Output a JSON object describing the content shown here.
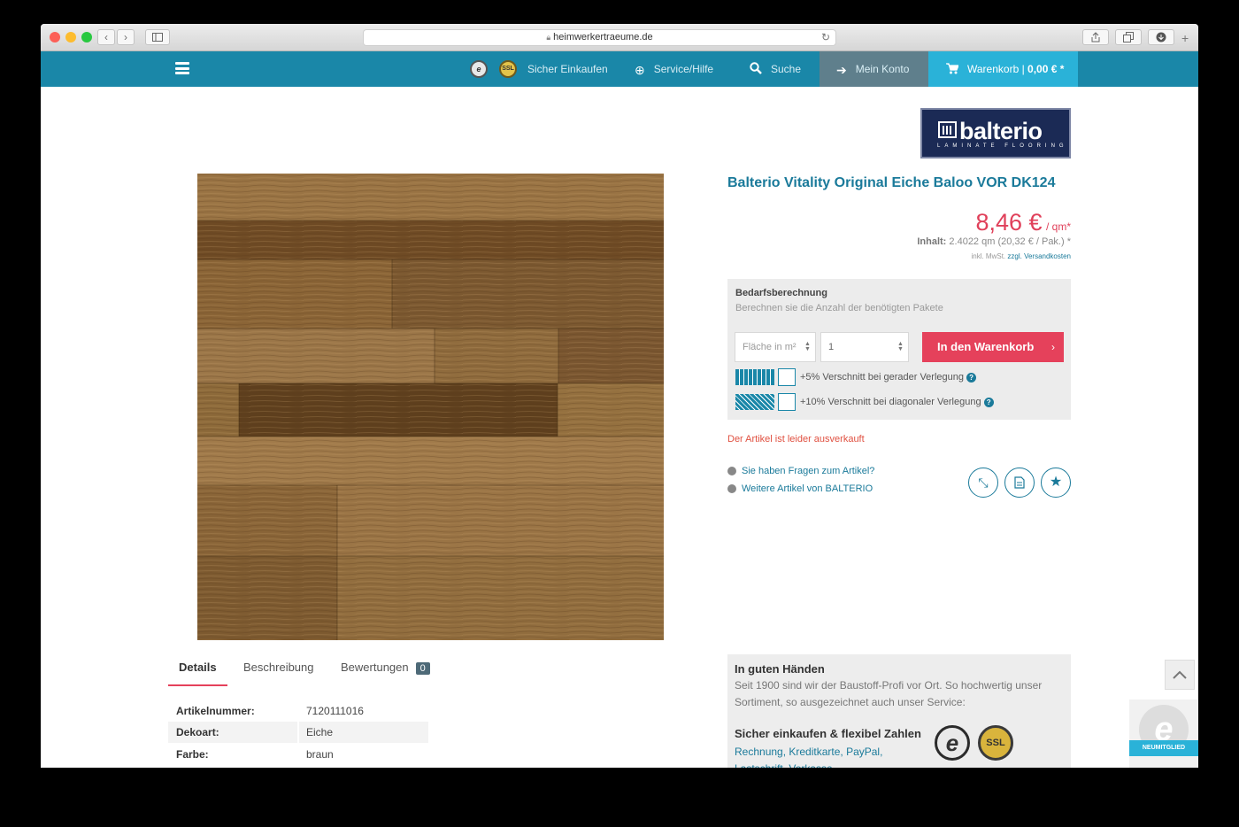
{
  "browser": {
    "url": "heimwerkertraeume.de",
    "back_label": "‹",
    "forward_label": "›"
  },
  "nav": {
    "secure_shopping": "Sicher Einkaufen",
    "service": "Service/Hilfe",
    "search": "Suche",
    "account": "Mein Konto",
    "cart_label": "Warenkorb",
    "cart_amount": "0,00 € *",
    "colors": {
      "bar": "#1a87a8",
      "account": "#5f7f8c",
      "cart": "#2ab2d8"
    }
  },
  "brand": {
    "name": "balterio",
    "tagline": "LAMINATE FLOORING"
  },
  "product": {
    "title": "Balterio Vitality Original Eiche Baloo VOR DK124",
    "price": "8,46 €",
    "price_unit": "/ qm*",
    "content_label": "Inhalt:",
    "content_value": "2.4022 qm (20,32 € / Pak.) *",
    "tax_note": "inkl. MwSt.",
    "shipping_link": "zzgl. Versandkosten",
    "sold_out": "Der Artikel ist leider ausverkauft",
    "accent_color": "#e0405a"
  },
  "calculator": {
    "heading": "Bedarfsberechnung",
    "subheading": "Berechnen sie die Anzahl der benötigten Pakete",
    "area_placeholder": "Fläche in m²",
    "quantity_value": "1",
    "add_to_cart": "In den Warenkorb",
    "option_straight": "+5% Verschnitt bei gerader Verlegung",
    "option_diagonal": "+10% Verschnitt bei diagonaler Verlegung"
  },
  "links": {
    "questions": "Sie haben Fragen zum Artikel?",
    "more_items": "Weitere Artikel von BALTERIO"
  },
  "tabs": {
    "details": "Details",
    "description": "Beschreibung",
    "reviews": "Bewertungen",
    "reviews_count": "0"
  },
  "properties": [
    {
      "key": "Artikelnummer:",
      "value": "7120111016"
    },
    {
      "key": "Dekoart:",
      "value": "Eiche"
    },
    {
      "key": "Farbe:",
      "value": "braun"
    }
  ],
  "trust": {
    "heading": "In guten Händen",
    "text": "Seit 1900 sind wir der Baustoff-Profi vor Ort. So hochwertig unser Sortiment, so ausgezeichnet auch unser Service:",
    "heading2": "Sicher einkaufen & flexibel Zahlen",
    "payments": "Rechnung, Kreditkarte, PayPal, Lastschrift, Vorkasse",
    "seal_ssl": "SSL",
    "member_label": "NEUMITGLIED"
  }
}
